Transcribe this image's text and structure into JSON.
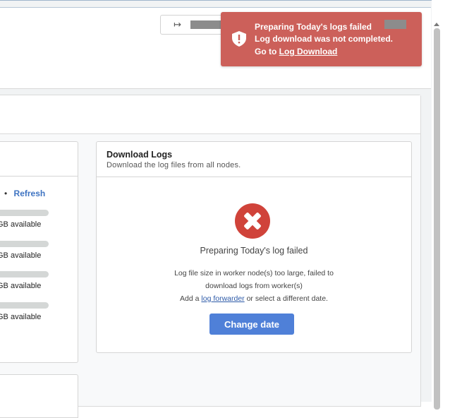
{
  "header": {
    "logout_icon": "sign-out-icon"
  },
  "storage": {
    "refresh_label": "Refresh",
    "items": [
      {
        "label": "GB available"
      },
      {
        "label": "GB available"
      },
      {
        "label": "GB available"
      },
      {
        "label": "GB available"
      }
    ]
  },
  "download_logs": {
    "title": "Download Logs",
    "subtitle": "Download the log files from all nodes.",
    "error_icon": "error-x-icon",
    "failed_message": "Preparing Today's log failed",
    "detail_line1": "Log file size in worker node(s) too large, failed to",
    "detail_line2": "download logs from worker(s)",
    "detail_line3_prefix": "Add a ",
    "detail_line3_link": "log forwarder",
    "detail_line3_suffix": " or select a different date.",
    "change_date_label": "Change date"
  },
  "toast": {
    "icon": "shield-alert-icon",
    "title": "Preparing Today's logs failed",
    "message": "Log download was not completed.",
    "goto_prefix": "Go to ",
    "goto_link": "Log Download",
    "color": "#cc605a"
  },
  "colors": {
    "accent": "#4f80d8",
    "link": "#3f74c2",
    "error": "#d0433a"
  }
}
